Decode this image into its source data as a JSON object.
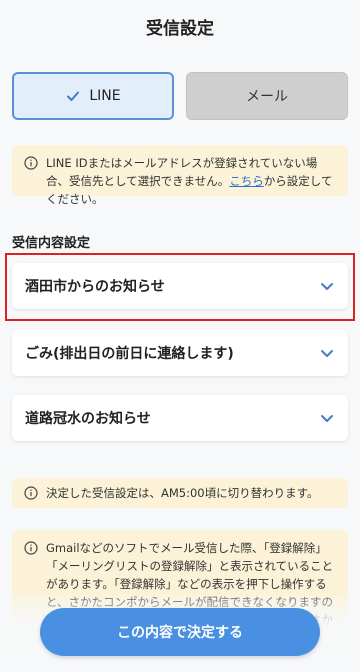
{
  "header": {
    "title": "受信設定"
  },
  "channels": {
    "line_label": "LINE",
    "mail_label": "メール",
    "selected": "LINE"
  },
  "notice_line": {
    "text_before": "LINE IDまたはメールアドレスが登録されていない場合、受信先として選択できません。",
    "link": "こちら",
    "text_after": "から設定してください。"
  },
  "content_settings": {
    "label": "受信内容設定",
    "items": [
      {
        "label": "酒田市からのお知らせ"
      },
      {
        "label": "ごみ(排出日の前日に連絡します)"
      },
      {
        "label": "道路冠水のお知らせ"
      }
    ]
  },
  "notice_time": {
    "text": "決定した受信設定は、AM5:00頃に切り替わります。"
  },
  "notice_gmail": {
    "text": "Gmailなどのソフトでメール受信した際、「登録解除」「メーリングリストの登録解除」と表示されていることがあります。「登録解除」などの表示を押下し操作すると、さかたコンポからメールが配信できなくなりますのでご注意ください。また、誤って操作した場合は、さかたコンポまでメールを"
  },
  "footer": {
    "submit_label": "この内容で決定する"
  },
  "colors": {
    "accent": "#4a90e2",
    "selected_bg": "#e3eefb",
    "notice_bg": "#fbf2d8",
    "highlight": "#e02020"
  },
  "icons": {
    "check": "check-icon",
    "info": "info-icon",
    "chevron": "chevron-down-icon"
  }
}
